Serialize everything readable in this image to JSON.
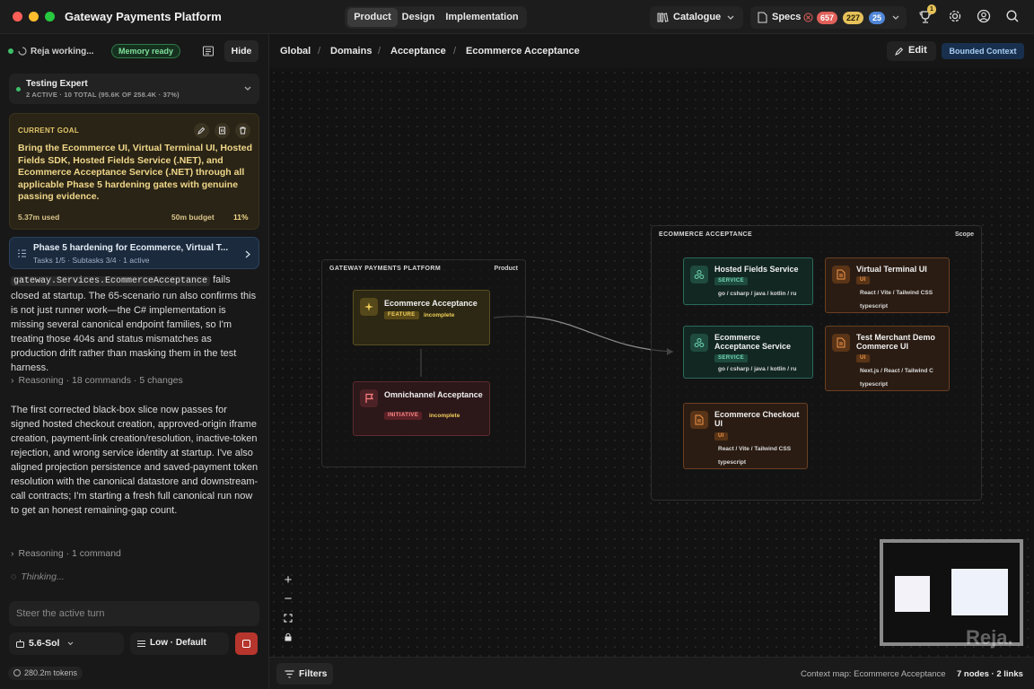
{
  "window": {
    "title": "Gateway Payments Platform",
    "mode_tabs": [
      "Product",
      "Design",
      "Implementation"
    ],
    "catalogue_label": "Catalogue",
    "specs_label": "Specs",
    "spec_counts": {
      "errors": "657",
      "warnings": "227",
      "info": "25"
    },
    "notification_count": "1",
    "colors": {
      "close": "#ff5f57",
      "minimize": "#febc2e",
      "maximize": "#28c840"
    }
  },
  "sidebar": {
    "status_text": "Reja working...",
    "memory_badge": "Memory ready",
    "hide_label": "Hide",
    "agent": {
      "name": "Testing Expert",
      "stats": "2 ACTIVE · 10 TOTAL (95.6K OF 258.4K · 37%)"
    },
    "goal": {
      "heading": "CURRENT GOAL",
      "text": "Bring the Ecommerce UI, Virtual Terminal UI, Hosted Fields SDK, Hosted Fields Service (.NET), and Ecommerce Acceptance Service (.NET) through all applicable Phase 5 hardening gates with genuine passing evidence.",
      "used": "5.37m used",
      "budget": "50m budget",
      "percent": "11%"
    },
    "task": {
      "title": "Phase 5 hardening for Ecommerce, Virtual T...",
      "sub": "Tasks 1/5 · Subtasks 3/4 · 1 active"
    },
    "message1_code": "gateway.Services.EcommerceAcceptance",
    "message1_text": " fails closed at startup. The 65-scenario run also confirms this is not just runner work—the C# implementation is missing several canonical endpoint families, so I'm treating those 404s and status mismatches as production drift rather than masking them in the test harness.",
    "reasoning1": "Reasoning · 18 commands · 5 changes",
    "message2": "The first corrected black-box slice now passes for signed hosted checkout creation, approved-origin iframe creation, payment-link creation/resolution, inactive-token rejection, and wrong service identity at startup. I've also aligned projection persistence and saved-payment token resolution with the canonical datastore and downstream-call contracts; I'm starting a fresh full canonical run now to get an honest remaining-gap count.",
    "reasoning2": "Reasoning · 1 command",
    "thinking": "Thinking...",
    "steer_placeholder": "Steer the active turn",
    "model": "5.6-Sol",
    "effort": "Low · Default",
    "tokens": "280.2m tokens"
  },
  "breadcrumb": {
    "items": [
      "Global",
      "Domains",
      "Acceptance",
      "Ecommerce Acceptance"
    ],
    "edit_label": "Edit",
    "context_badge": "Bounded Context"
  },
  "canvas": {
    "group_platform": {
      "title": "GATEWAY PAYMENTS PLATFORM",
      "tag": "Product"
    },
    "group_ecommerce": {
      "title": "ECOMMERCE ACCEPTANCE",
      "tag": "Scope"
    },
    "nodes": {
      "ecommerce_acceptance": {
        "title": "Ecommerce Acceptance",
        "chip": "FEATURE",
        "status": "incomplete"
      },
      "omnichannel": {
        "title": "Omnichannel Acceptance",
        "chip": "INITIATIVE",
        "status": "incomplete"
      },
      "hosted_fields": {
        "title": "Hosted Fields Service",
        "chip": "SERVICE",
        "meta": "go / csharp / java / kotlin / ru"
      },
      "ecom_service": {
        "title": "Ecommerce Acceptance Service",
        "chip": "SERVICE",
        "meta": "go / csharp / java / kotlin / ru"
      },
      "virtual_terminal": {
        "title": "Virtual Terminal UI",
        "chip": "UI",
        "meta": "React / Vite / Tailwind CSS",
        "meta2": "typescript"
      },
      "test_merchant": {
        "title": "Test Merchant Demo Commerce UI",
        "chip": "UI",
        "meta": "Next.js / React / Tailwind C",
        "meta2": "typescript"
      },
      "ecom_checkout": {
        "title": "Ecommerce Checkout UI",
        "chip": "UI",
        "meta": "React / Vite / Tailwind CSS",
        "meta2": "typescript"
      }
    }
  },
  "bottom": {
    "filters_label": "Filters",
    "context_text": "Context map: Ecommerce Acceptance",
    "counts": "7 nodes · 2 links",
    "watermark": "Reja."
  }
}
